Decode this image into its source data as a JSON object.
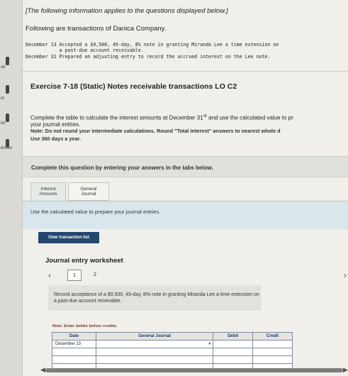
{
  "sidebar": {
    "items": [
      {
        "label": "ok"
      },
      {
        "label": "nt"
      },
      {
        "label": "int"
      },
      {
        "label": "ences"
      }
    ]
  },
  "header": {
    "intro": "[The following information applies to the questions displayed below.]",
    "following": "Following are transactions of Danica Company.",
    "transactions": [
      "December 13 Accepted a $9,500, 45-day, 8% note in granting Miranda Lee a time extension on",
      "            a past-due account receivable.",
      "December 31 Prepared an adjusting entry to record the accrued interest on the Lee note."
    ]
  },
  "exercise": {
    "title": "Exercise 7-18 (Static) Notes receivable transactions LO C2",
    "instruction_part1": "Complete the table to calculate the interest amounts at December 31",
    "instruction_sup": "st",
    "instruction_part2": " and use the calculated value to pr",
    "instruction_line2": "your journal entries.",
    "note1": "Note: Do not round your intermediate calculations. Round \"Total Interest\" answers to nearest whole d",
    "note2": "Use 360 days a year."
  },
  "complete_prompt": "Complete this question by entering your answers in the tabs below.",
  "tabs": [
    {
      "label_line1": "Interest",
      "label_line2": "Amounts"
    },
    {
      "label_line1": "General",
      "label_line2": "Journal"
    }
  ],
  "tab_panel_text": "Use the calculated value to prepare your journal entries.",
  "view_transaction_list": "View transaction list",
  "worksheet": {
    "title": "Journal entry worksheet",
    "pages": [
      "1",
      "2"
    ],
    "record_text": "Record acceptance of a $9,500, 45-day, 8% note in granting Miranda Lee a time extension on a past-due account receivable.",
    "note": "Note: Enter debits before credits.",
    "columns": [
      "Date",
      "General Journal",
      "Debit",
      "Credit"
    ],
    "rows": [
      {
        "date": "December 13",
        "account": "",
        "debit": "",
        "credit": ""
      },
      {
        "date": "",
        "account": "",
        "debit": "",
        "credit": ""
      },
      {
        "date": "",
        "account": "",
        "debit": "",
        "credit": ""
      },
      {
        "date": "",
        "account": "",
        "debit": "",
        "credit": ""
      }
    ]
  },
  "icons": {
    "prev": "chevron-left-icon",
    "next": "chevron-right-icon",
    "dropdown": "dropdown-triangle-icon"
  },
  "colors": {
    "button_bg": "#23476f",
    "tab_panel_bg": "#d9e7ec",
    "header_text": "#1a3a6a"
  }
}
